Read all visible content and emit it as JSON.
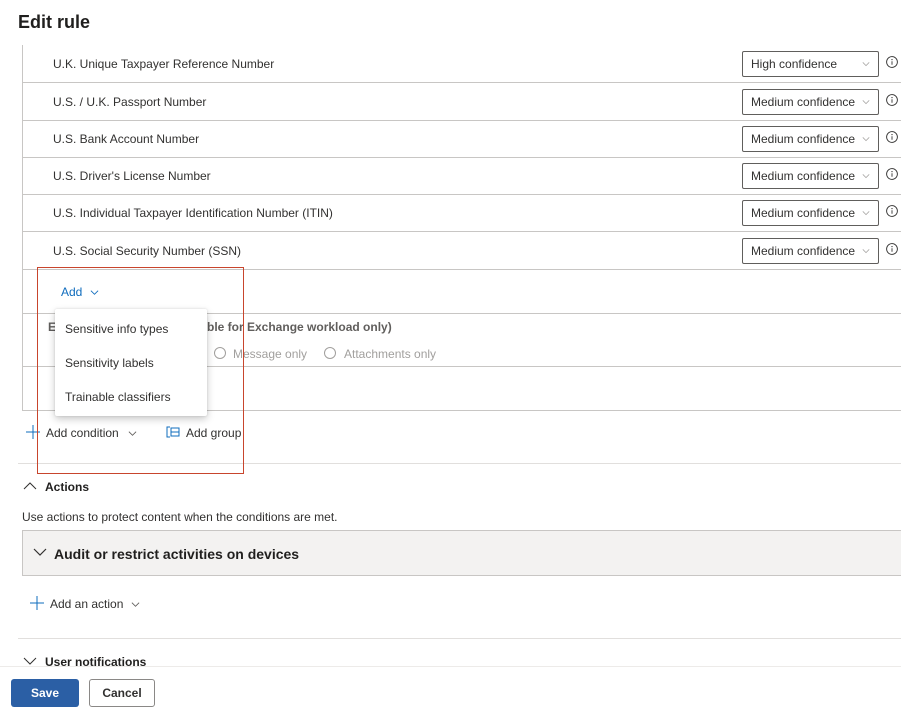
{
  "page": {
    "title": "Edit rule"
  },
  "conditions": {
    "rows": [
      {
        "label": "U.K. Unique Taxpayer Reference Number",
        "confidence": "High confidence"
      },
      {
        "label": "U.S. / U.K. Passport Number",
        "confidence": "Medium confidence"
      },
      {
        "label": "U.S. Bank Account Number",
        "confidence": "Medium confidence"
      },
      {
        "label": "U.S. Driver's License Number",
        "confidence": "Medium confidence"
      },
      {
        "label": "U.S. Individual Taxpayer Identification Number (ITIN)",
        "confidence": "Medium confidence"
      },
      {
        "label": "U.S. Social Security Number (SSN)",
        "confidence": "Medium confidence"
      }
    ],
    "add_label": "Add",
    "except_label": "E",
    "except_label_tail": "ble for Exchange workload only)",
    "radio_options": [
      "Message only",
      "Attachments only"
    ],
    "add_condition_label": "Add condition",
    "add_group_label": "Add group"
  },
  "add_menu": {
    "items": [
      "Sensitive info types",
      "Sensitivity labels",
      "Trainable classifiers"
    ]
  },
  "actions": {
    "heading": "Actions",
    "description": "Use actions to protect content when the conditions are met.",
    "audit_label": "Audit or restrict activities on devices",
    "add_action_label": "Add an action"
  },
  "user_notifications": {
    "heading": "User notifications"
  },
  "footer": {
    "save_label": "Save",
    "cancel_label": "Cancel"
  },
  "colors": {
    "accent": "#0f6cbd",
    "primary_button": "#2b5fa5",
    "highlight": "#c8452d"
  }
}
